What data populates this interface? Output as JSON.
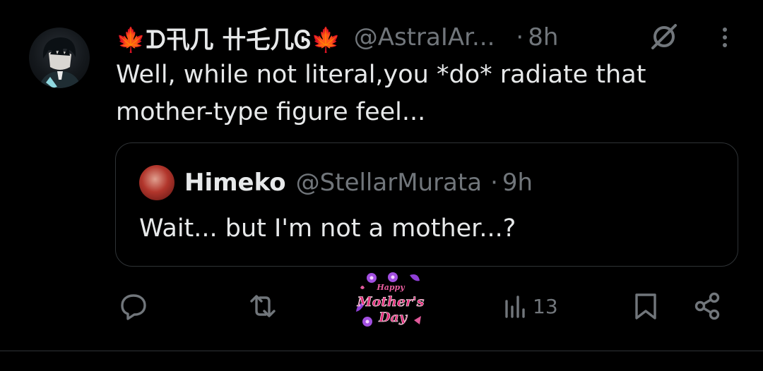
{
  "tweet": {
    "display_name": "🍁ᗪ卂几 卄乇几Ꮆ🍁",
    "handle": "@AstraIAr...",
    "dot": "·",
    "time": "8h",
    "text": "Well, while not literal,you *do* radiate that mother-type figure feel..."
  },
  "quote": {
    "display_name": "Himeko",
    "handle": "@StellarMurata",
    "dot": "·",
    "time": "9h",
    "text": "Wait... but I'm not a mother...?"
  },
  "actions": {
    "reply_icon": "reply-icon",
    "retweet_icon": "retweet-icon",
    "sticker_text": [
      "Happy",
      "Mother's",
      "Day"
    ],
    "views_icon": "views-icon",
    "views_count": "13",
    "bookmark_icon": "bookmark-icon",
    "share_icon": "share-icon"
  },
  "colors": {
    "background": "#000000",
    "text_primary": "#e7e9ea",
    "text_secondary": "#71767b",
    "border": "#2f3336",
    "sticker_pink": "#d8347e",
    "sticker_purple": "#8a4fd0"
  }
}
